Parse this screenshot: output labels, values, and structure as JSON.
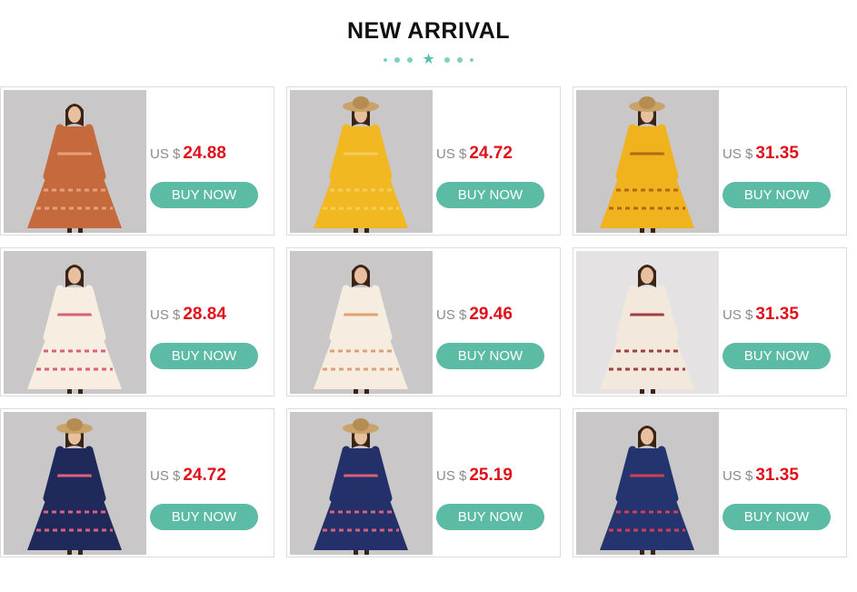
{
  "section": {
    "title": "NEW ARRIVAL"
  },
  "accent_color": "#5cbba5",
  "price_color": "#e0101b",
  "products": [
    {
      "currency": "US $",
      "price": "24.88",
      "button": "BUY NOW",
      "dress_color": "#c56a3d",
      "pattern": "#e8a07a",
      "bg": "#c9c7c8",
      "hat": false
    },
    {
      "currency": "US $",
      "price": "24.72",
      "button": "BUY NOW",
      "dress_color": "#f1b822",
      "pattern": "#f5cd57",
      "bg": "#c9c7c8",
      "hat": true
    },
    {
      "currency": "US $",
      "price": "31.35",
      "button": "BUY NOW",
      "dress_color": "#f0b21d",
      "pattern": "#b06a14",
      "bg": "#c9c7c8",
      "hat": true
    },
    {
      "currency": "US $",
      "price": "28.84",
      "button": "BUY NOW",
      "dress_color": "#f7ede0",
      "pattern": "#d9607c",
      "bg": "#c9c7c8",
      "hat": false
    },
    {
      "currency": "US $",
      "price": "29.46",
      "button": "BUY NOW",
      "dress_color": "#f6ede0",
      "pattern": "#e0a070",
      "bg": "#c9c7c8",
      "hat": false
    },
    {
      "currency": "US $",
      "price": "31.35",
      "button": "BUY NOW",
      "dress_color": "#f2e9dc",
      "pattern": "#a04040",
      "bg": "#e4e2e3",
      "hat": false
    },
    {
      "currency": "US $",
      "price": "24.72",
      "button": "BUY NOW",
      "dress_color": "#1f2a5a",
      "pattern": "#e06080",
      "bg": "#c9c7c8",
      "hat": true
    },
    {
      "currency": "US $",
      "price": "25.19",
      "button": "BUY NOW",
      "dress_color": "#23306a",
      "pattern": "#d86078",
      "bg": "#c9c7c8",
      "hat": true
    },
    {
      "currency": "US $",
      "price": "31.35",
      "button": "BUY NOW",
      "dress_color": "#23346e",
      "pattern": "#d04050",
      "bg": "#c9c7c8",
      "hat": false
    }
  ]
}
